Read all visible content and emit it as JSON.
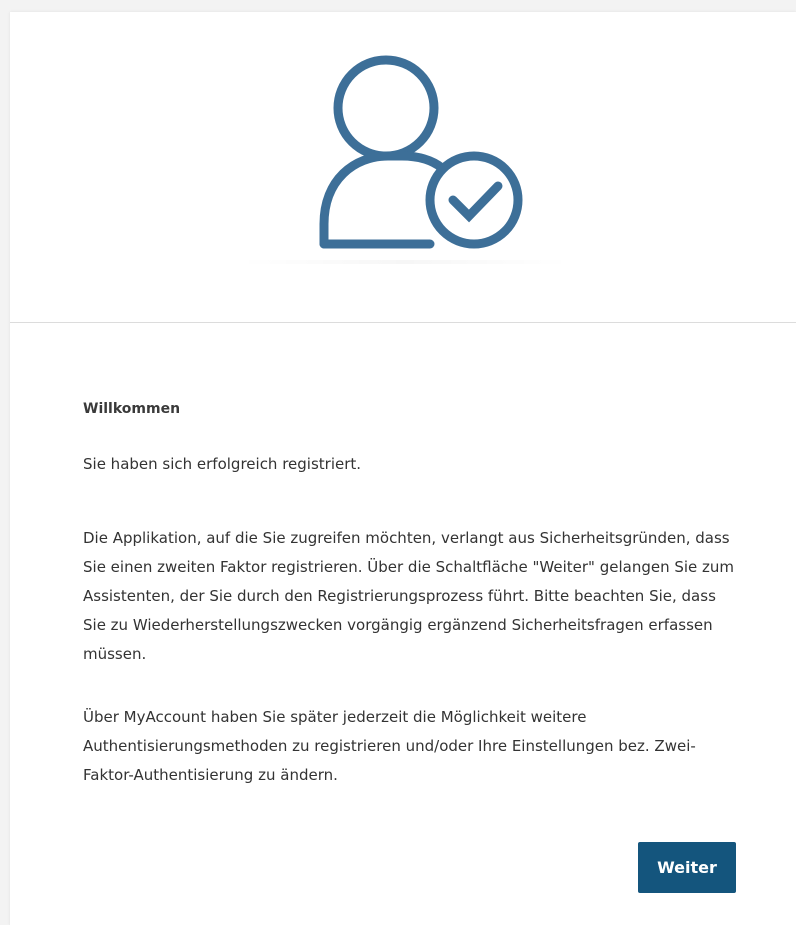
{
  "welcome": {
    "heading": "Willkommen",
    "registered_text": "Sie haben sich erfolgreich registriert.",
    "info_text": "Die Applikation, auf die Sie zugreifen möchten, verlangt aus Sicherheitsgründen, dass Sie einen zweiten Faktor registrieren. Über die Schaltfläche \"Weiter\" gelangen Sie zum Assistenten, der Sie durch den Registrierungsprozess führt. Bitte beachten Sie, dass Sie zu Wiederherstellungszwecken vorgängig ergänzend Sicherheitsfragen erfassen müssen.",
    "myaccount_text": "Über MyAccount haben Sie später jederzeit die Möglichkeit weitere Authentisierungsmethoden zu registrieren und/oder Ihre Einstellungen bez. Zwei-Faktor-Authentisierung zu ändern."
  },
  "actions": {
    "continue_label": "Weiter"
  },
  "icons": {
    "hero": "user-check-icon"
  },
  "colors": {
    "icon": "#3d6f98",
    "button": "#14557d",
    "divider": "#dcdcdc",
    "text": "#333333"
  }
}
